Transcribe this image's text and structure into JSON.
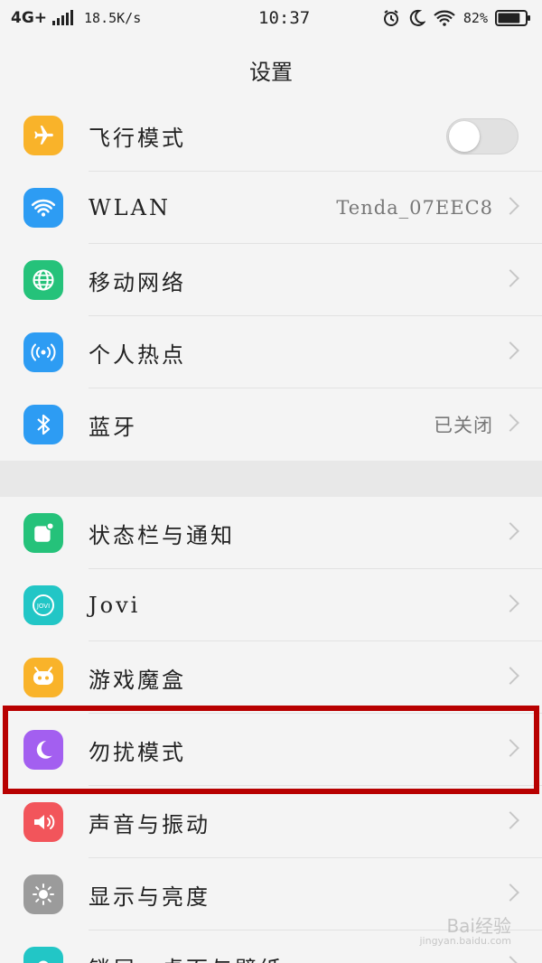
{
  "status_bar": {
    "network": "4G+",
    "speed": "18.5K/s",
    "time": "10:37",
    "battery_percent": "82%",
    "battery_level": 0.82
  },
  "header": {
    "title": "设置"
  },
  "group1": [
    {
      "label": "飞行模式",
      "icon": "airplane-icon",
      "color": "#f9b32a",
      "toggle": false
    },
    {
      "label": "WLAN",
      "icon": "wifi-icon",
      "color": "#2d9cf3",
      "value": "Tenda_07EEC8"
    },
    {
      "label": "移动网络",
      "icon": "globe-icon",
      "color": "#25c27a"
    },
    {
      "label": "个人热点",
      "icon": "hotspot-icon",
      "color": "#2d9cf3"
    },
    {
      "label": "蓝牙",
      "icon": "bluetooth-icon",
      "color": "#2d9cf3",
      "value": "已关闭"
    }
  ],
  "group2": [
    {
      "label": "状态栏与通知",
      "icon": "notification-icon",
      "color": "#25c27a"
    },
    {
      "label": "Jovi",
      "icon": "jovi-icon",
      "color": "#22c6c6"
    },
    {
      "label": "游戏魔盒",
      "icon": "game-icon",
      "color": "#f9b32a"
    },
    {
      "label": "勿扰模式",
      "icon": "moon-icon",
      "color": "#a35ff0"
    },
    {
      "label": "声音与振动",
      "icon": "speaker-icon",
      "color": "#f2555b"
    },
    {
      "label": "显示与亮度",
      "icon": "brightness-icon",
      "color": "#9b9b9b"
    },
    {
      "label": "锁屏、桌面与壁纸",
      "icon": "wallpaper-icon",
      "color": "#22c6c6"
    }
  ],
  "watermark": {
    "text": "Bai经验",
    "sub": "jingyan.baidu.com"
  }
}
